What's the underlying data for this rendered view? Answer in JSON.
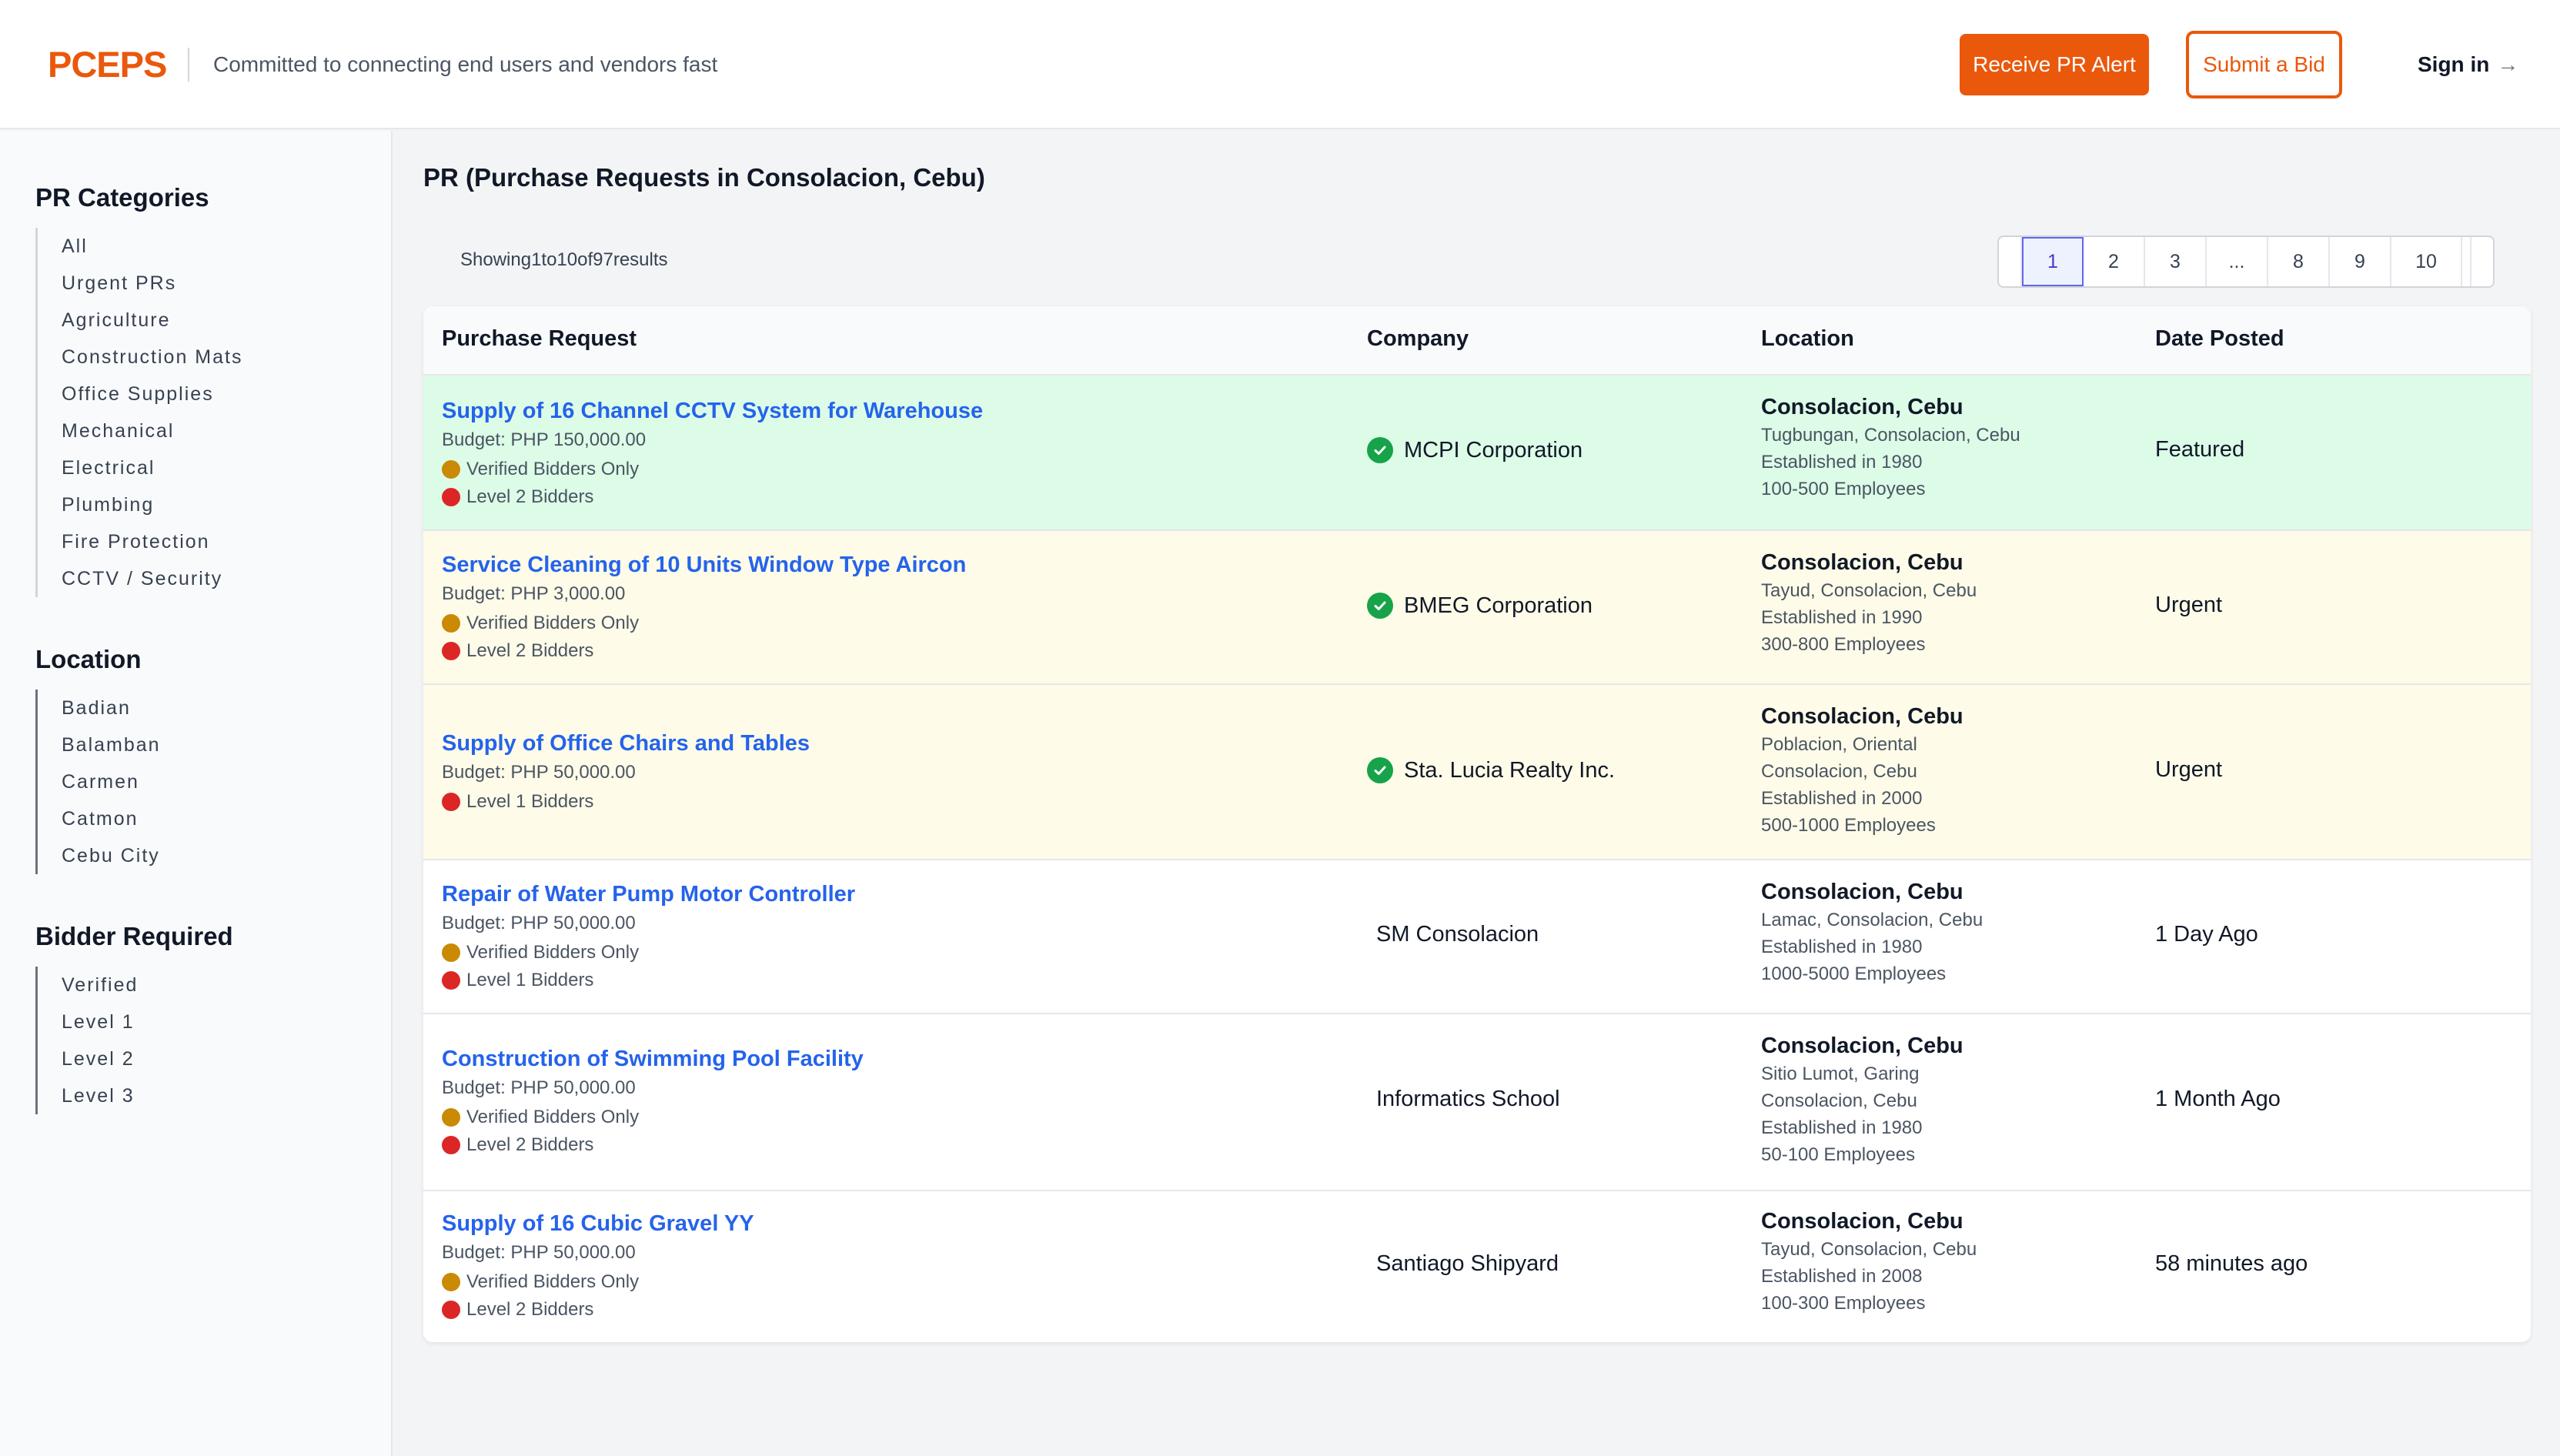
{
  "header": {
    "logo": "PCEPS",
    "tagline": "Committed to connecting end users and vendors fast",
    "alert_button": "Receive PR Alert",
    "bid_button": "Submit a Bid",
    "signin_label": "Sign in",
    "signin_arrow": "→"
  },
  "colors": {
    "brand": "#ea580c",
    "link": "#2563eb",
    "featured_bg": "#dcfce7",
    "urgent_bg": "#fefce8",
    "verified_check": "#16a34a"
  },
  "sidebar": {
    "categories_title": "PR Categories",
    "categories": [
      "All",
      "Urgent PRs",
      "Agriculture",
      "Construction Mats",
      "Office Supplies",
      "Mechanical",
      "Electrical",
      "Plumbing",
      "Fire Protection",
      "CCTV / Security"
    ],
    "location_title": "Location",
    "locations": [
      "Badian",
      "Balamban",
      "Carmen",
      "Catmon",
      "Cebu City"
    ],
    "bidder_title": "Bidder Required",
    "bidders": [
      "Verified",
      "Level 1",
      "Level 2",
      "Level 3"
    ]
  },
  "main": {
    "title": "PR (Purchase Requests in Consolacion, Cebu)",
    "showing_text": "Showing1to10of97results",
    "pagination": [
      "1",
      "2",
      "3",
      "...",
      "8",
      "9",
      "10"
    ],
    "pagination_active": "1",
    "columns": [
      "Purchase Request",
      "Company",
      "Location",
      "Date Posted"
    ],
    "rows": [
      {
        "title": "Supply of 16 Channel CCTV System for Warehouse",
        "budget": "Budget: PHP 150,000.00",
        "tags": [
          {
            "text": "Verified Bidders Only",
            "color": "amber"
          },
          {
            "text": "Level 2 Bidders",
            "color": "red"
          }
        ],
        "company": "MCPI Corporation",
        "verified": true,
        "city": "Consolacion, Cebu",
        "address": [
          "Tugbungan, Consolacion, Cebu"
        ],
        "established": "Established in 1980",
        "employees": "100-500 Employees",
        "date": "Featured",
        "highlight": "featured"
      },
      {
        "title": "Service Cleaning of 10 Units Window Type Aircon",
        "budget": "Budget: PHP 3,000.00",
        "tags": [
          {
            "text": "Verified Bidders Only",
            "color": "amber"
          },
          {
            "text": "Level 2 Bidders",
            "color": "red"
          }
        ],
        "company": "BMEG Corporation",
        "verified": true,
        "city": "Consolacion, Cebu",
        "address": [
          "Tayud, Consolacion, Cebu"
        ],
        "established": "Established in 1990",
        "employees": "300-800 Employees",
        "date": "Urgent",
        "highlight": "urgent"
      },
      {
        "title": "Supply of Office Chairs and Tables",
        "budget": "Budget: PHP 50,000.00",
        "tags": [
          {
            "text": "Level 1 Bidders",
            "color": "red"
          }
        ],
        "company": "Sta. Lucia Realty Inc.",
        "verified": true,
        "city": "Consolacion, Cebu",
        "address": [
          "Poblacion, Oriental",
          "Consolacion, Cebu"
        ],
        "established": "Established in 2000",
        "employees": "500-1000 Employees",
        "date": "Urgent",
        "highlight": "urgent"
      },
      {
        "title": "Repair of Water Pump Motor Controller",
        "budget": "Budget: PHP 50,000.00",
        "tags": [
          {
            "text": "Verified Bidders Only",
            "color": "amber"
          },
          {
            "text": "Level 1 Bidders",
            "color": "red"
          }
        ],
        "company": "SM Consolacion",
        "verified": false,
        "city": "Consolacion, Cebu",
        "address": [
          "Lamac, Consolacion, Cebu"
        ],
        "established": "Established in 1980",
        "employees": "1000-5000 Employees",
        "date": "1 Day Ago",
        "highlight": "none"
      },
      {
        "title": "Construction of Swimming Pool Facility",
        "budget": "Budget: PHP 50,000.00",
        "tags": [
          {
            "text": "Verified Bidders Only",
            "color": "amber"
          },
          {
            "text": "Level 2 Bidders",
            "color": "red"
          }
        ],
        "company": "Informatics School",
        "verified": false,
        "city": "Consolacion, Cebu",
        "address": [
          "Sitio Lumot, Garing",
          "Consolacion, Cebu"
        ],
        "established": "Established in 1980",
        "employees": "50-100 Employees",
        "date": "1 Month Ago",
        "highlight": "none"
      },
      {
        "title": "Supply of 16 Cubic Gravel YY",
        "budget": "Budget: PHP 50,000.00",
        "tags": [
          {
            "text": "Verified Bidders Only",
            "color": "amber"
          },
          {
            "text": "Level 2 Bidders",
            "color": "red"
          }
        ],
        "company": "Santiago Shipyard",
        "verified": false,
        "city": "Consolacion, Cebu",
        "address": [
          "Tayud, Consolacion, Cebu"
        ],
        "established": "Established in 2008",
        "employees": "100-300 Employees",
        "date": "58 minutes ago",
        "highlight": "none"
      }
    ]
  }
}
